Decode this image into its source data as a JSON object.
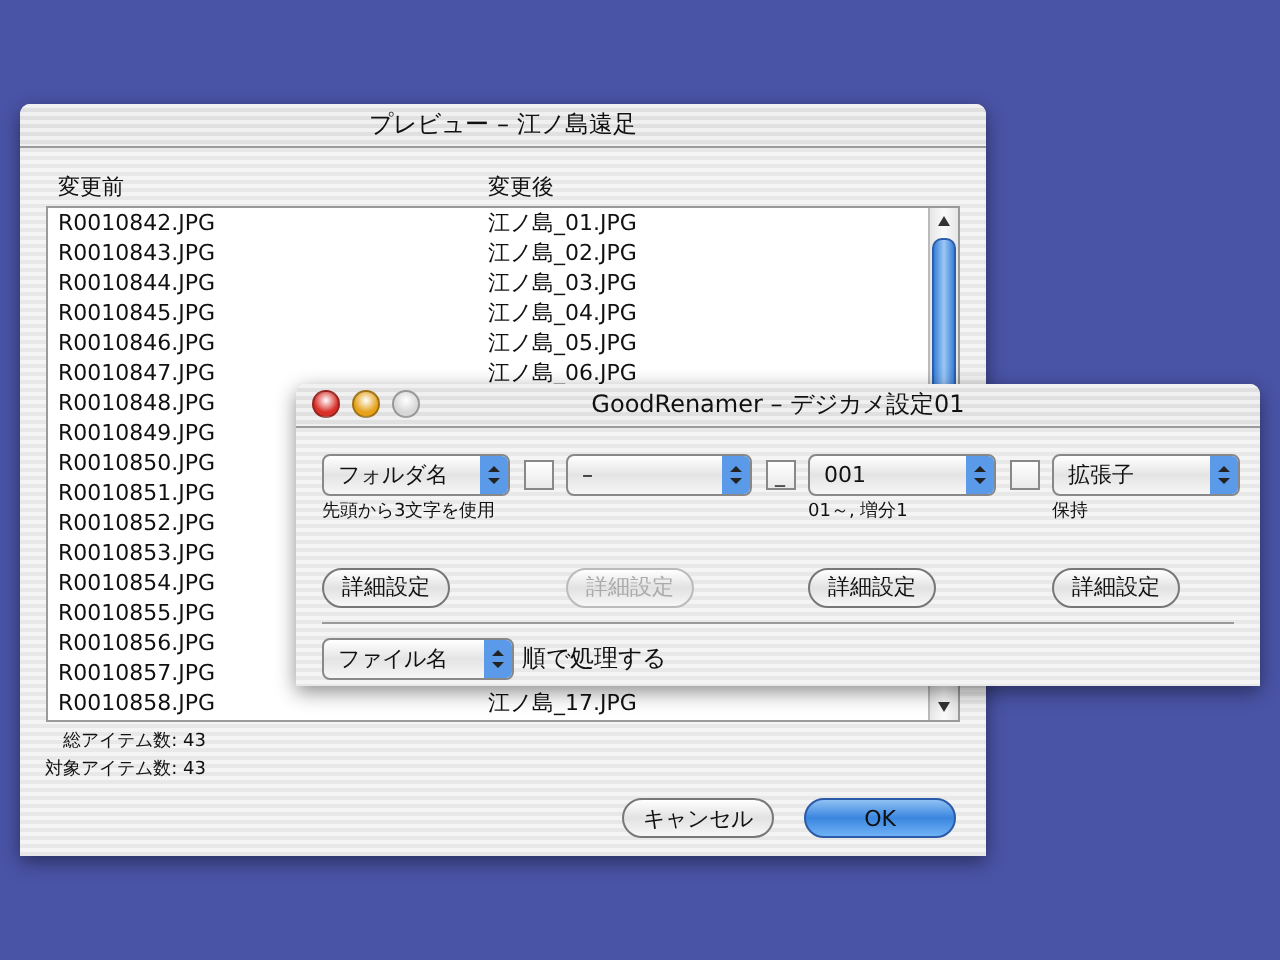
{
  "preview_window": {
    "title": "プレビュー – 江ノ島遠足",
    "columns": [
      "変更前",
      "変更後"
    ],
    "rows": [
      {
        "before": "R0010842.JPG",
        "after": "江ノ島_01.JPG"
      },
      {
        "before": "R0010843.JPG",
        "after": "江ノ島_02.JPG"
      },
      {
        "before": "R0010844.JPG",
        "after": "江ノ島_03.JPG"
      },
      {
        "before": "R0010845.JPG",
        "after": "江ノ島_04.JPG"
      },
      {
        "before": "R0010846.JPG",
        "after": "江ノ島_05.JPG"
      },
      {
        "before": "R0010847.JPG",
        "after": "江ノ島_06.JPG"
      },
      {
        "before": "R0010848.JPG"
      },
      {
        "before": "R0010849.JPG"
      },
      {
        "before": "R0010850.JPG"
      },
      {
        "before": "R0010851.JPG"
      },
      {
        "before": "R0010852.JPG"
      },
      {
        "before": "R0010853.JPG"
      },
      {
        "before": "R0010854.JPG"
      },
      {
        "before": "R0010855.JPG"
      },
      {
        "before": "R0010856.JPG"
      },
      {
        "before": "R0010857.JPG"
      },
      {
        "before": "R0010858.JPG",
        "after": "江ノ島_17.JPG"
      }
    ],
    "totals": [
      "総アイテム数: 43",
      "対象アイテム数: 43"
    ],
    "buttons": [
      {
        "label": "キャンセル",
        "default": false
      },
      {
        "label": "OK",
        "default": true
      }
    ]
  },
  "settings_window": {
    "title": "GoodRenamer – デジカメ設定01",
    "segments": [
      {
        "value": "フォルダ名",
        "note": "先頭から3文字を使用",
        "button": {
          "label": "詳細設定",
          "disabled": false
        }
      },
      {
        "value": "–",
        "button": {
          "label": "詳細設定",
          "disabled": true
        }
      },
      {
        "value": "001",
        "note": "01～, 増分1",
        "button": {
          "label": "詳細設定",
          "disabled": false
        }
      },
      {
        "value": "拡張子",
        "note": "保持",
        "button": {
          "label": "詳細設定",
          "disabled": false
        }
      }
    ],
    "separators": [
      {
        "checked": false
      },
      {
        "checked": false,
        "label": "_"
      },
      {
        "checked": false
      }
    ],
    "order": {
      "value": "ファイル名",
      "text": "順で処理する"
    }
  }
}
